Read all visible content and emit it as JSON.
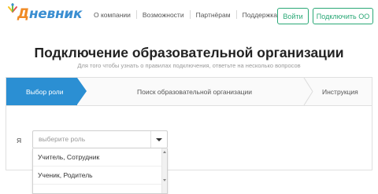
{
  "header": {
    "logo": {
      "text_prefix": "Д",
      "text_rest": "невник"
    },
    "nav": [
      {
        "label": "О компании"
      },
      {
        "label": "Возможности"
      },
      {
        "label": "Партнёрам"
      },
      {
        "label": "Поддержка"
      }
    ],
    "login_label": "Войти",
    "connect_label": "Подключить ОО"
  },
  "main": {
    "title": "Подключение образовательной организации",
    "subtitle": "Для того чтобы узнать о правилах подключения, ответьте на несколько вопросов"
  },
  "stepper": {
    "steps": [
      {
        "label": "Выбор роли",
        "active": true
      },
      {
        "label": "Поиск образовательной организации",
        "active": false
      },
      {
        "label": "Инструкция",
        "active": false
      }
    ]
  },
  "form": {
    "role_label": "Я",
    "select_placeholder": "выберите роль",
    "options": [
      {
        "label": "Учитель, Сотрудник"
      },
      {
        "label": "Ученик, Родитель"
      }
    ]
  },
  "colors": {
    "accent_blue": "#2b8fd3",
    "accent_green": "#2aa876",
    "logo_orange": "#f08a24"
  }
}
